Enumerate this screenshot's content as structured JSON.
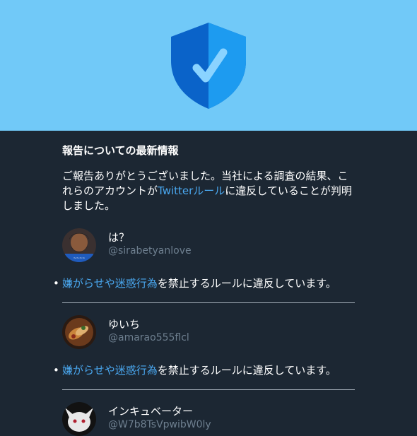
{
  "banner": {
    "background": "#71c9f8",
    "icon": "shield-check-icon",
    "shield_dark": "#0a63c9",
    "shield_light": "#1d9bf0",
    "check_color": "#8ad3ff"
  },
  "report": {
    "title": "報告についての最新情報",
    "intro_part1": "ご報告ありがとうございました。当社による調査の結果、これらのアカウントが",
    "intro_link": "Twitterルール",
    "intro_part2": "に違反していることが判明しました。"
  },
  "accounts": [
    {
      "name": "は？",
      "handle": "@sirabetyanlove",
      "avatar_icon": "avatar-photo-icon",
      "violation_link": "嫌がらせや迷惑行為",
      "violation_text": "を禁止するルールに違反しています。"
    },
    {
      "name": "ゆいち",
      "handle": "@amarao555flcl",
      "avatar_icon": "avatar-photo-icon",
      "violation_link": "嫌がらせや迷惑行為",
      "violation_text": "を禁止するルールに違反しています。"
    },
    {
      "name": "インキュベーター",
      "handle": "@W7b8TsVpwibW0ly",
      "avatar_icon": "avatar-photo-icon"
    }
  ],
  "colors": {
    "background": "#1c2733",
    "link": "#4aa8f0",
    "handle": "#6e7f8f"
  }
}
